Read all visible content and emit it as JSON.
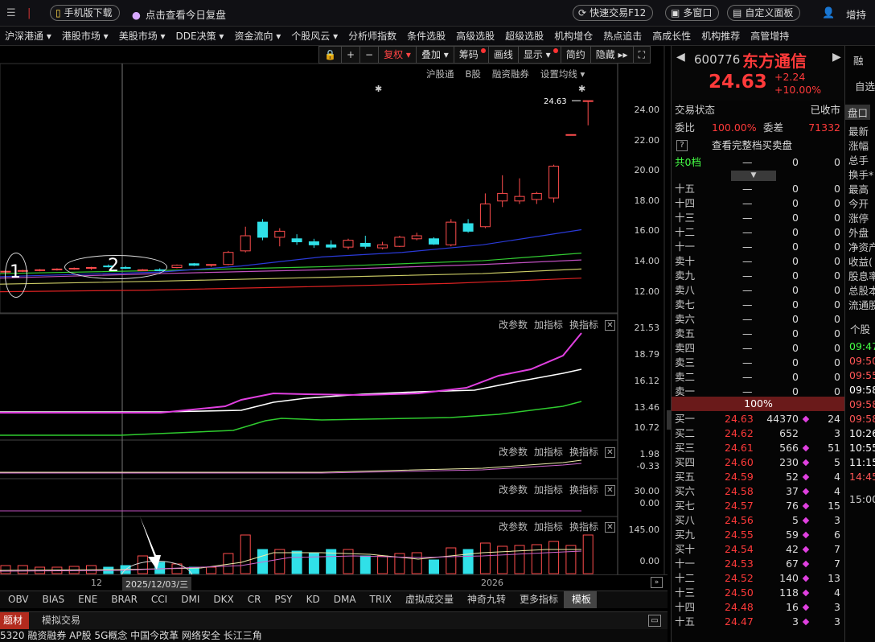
{
  "topbar": {
    "mobile_download": "手机版下载",
    "replay": "点击查看今日复盘",
    "quick_trade": "快速交易F12",
    "multi_window": "多窗口",
    "custom_panel": "自定义面板",
    "add_self": "增持"
  },
  "menu": [
    "沪深港通 ▾",
    "港股市场 ▾",
    "美股市场 ▾",
    "DDE决策 ▾",
    "资金流向 ▾",
    "个股风云 ▾",
    "分析师指数",
    "条件选股",
    "高级选股",
    "超级选股",
    "机构增仓",
    "热点追击",
    "高成长性",
    "机构推荐",
    "高管增持"
  ],
  "toolbar": {
    "fuquan": "复权",
    "diejia": "叠加",
    "chouma": "筹码",
    "huaxian": "画线",
    "xianshi": "显示",
    "jianyue": "简约",
    "yincang": "隐藏"
  },
  "subbar": [
    "沪股通",
    "B股",
    "融资融券",
    "设置均线 ▾"
  ],
  "price_axis": [
    "24.00",
    "22.00",
    "20.00",
    "18.00",
    "16.00",
    "14.00",
    "12.00"
  ],
  "price_label": "24.63",
  "annotations": {
    "one": "1",
    "two": "2",
    "date": "2025/12/03/三"
  },
  "ind_panels": [
    {
      "params": "改参数",
      "add": "加指标",
      "swap": "换指标",
      "axis": [
        "21.53",
        "18.79",
        "16.12",
        "13.46",
        "10.72"
      ]
    },
    {
      "params": "改参数",
      "add": "加指标",
      "swap": "换指标",
      "axis": [
        "1.98",
        "-0.33"
      ]
    },
    {
      "params": "改参数",
      "add": "加指标",
      "swap": "换指标",
      "axis": [
        "30.00",
        "0.00"
      ]
    },
    {
      "params": "改参数",
      "add": "加指标",
      "swap": "换指标",
      "axis": [
        "145.00",
        "0.00"
      ]
    }
  ],
  "timeaxis": {
    "left": "12",
    "year": "2026"
  },
  "bottom_tabs": [
    "OBV",
    "BIAS",
    "ENE",
    "BRAR",
    "CCI",
    "DMI",
    "DKX",
    "CR",
    "PSY",
    "KD",
    "DMA",
    "TRIX",
    "虚拟成交量",
    "神奇九转",
    "更多指标",
    "模板"
  ],
  "status_tabs": [
    "题材",
    "模拟交易"
  ],
  "status_ticker": "5320  融资融券  AP股  5G概念  中国今改革  网络安全  长江三角",
  "stock": {
    "code": "600776",
    "name": "东方通信",
    "price": "24.63",
    "change": "+2.24",
    "pct": "+10.00%",
    "state_label": "交易状态",
    "state": "已收市",
    "webi_label": "委比",
    "webi": "100.00%",
    "wecha_label": "委差",
    "wecha": "71332",
    "full_book": "查看完整档买卖盘",
    "total_label": "共0档",
    "total_dash": "—",
    "total_v": "0",
    "total_c": "0",
    "pct_bar": "100%"
  },
  "sells": [
    {
      "l": "十五",
      "p": "—",
      "v": "0",
      "c": "0"
    },
    {
      "l": "十四",
      "p": "—",
      "v": "0",
      "c": "0"
    },
    {
      "l": "十三",
      "p": "—",
      "v": "0",
      "c": "0"
    },
    {
      "l": "十二",
      "p": "—",
      "v": "0",
      "c": "0"
    },
    {
      "l": "十一",
      "p": "—",
      "v": "0",
      "c": "0"
    },
    {
      "l": "卖十",
      "p": "—",
      "v": "0",
      "c": "0"
    },
    {
      "l": "卖九",
      "p": "—",
      "v": "0",
      "c": "0"
    },
    {
      "l": "卖八",
      "p": "—",
      "v": "0",
      "c": "0"
    },
    {
      "l": "卖七",
      "p": "—",
      "v": "0",
      "c": "0"
    },
    {
      "l": "卖六",
      "p": "—",
      "v": "0",
      "c": "0"
    },
    {
      "l": "卖五",
      "p": "—",
      "v": "0",
      "c": "0"
    },
    {
      "l": "卖四",
      "p": "—",
      "v": "0",
      "c": "0"
    },
    {
      "l": "卖三",
      "p": "—",
      "v": "0",
      "c": "0"
    },
    {
      "l": "卖二",
      "p": "—",
      "v": "0",
      "c": "0"
    },
    {
      "l": "卖一",
      "p": "—",
      "v": "0",
      "c": "0"
    }
  ],
  "buys": [
    {
      "l": "买一",
      "p": "24.63",
      "v": "44370",
      "c": "24",
      "m": true
    },
    {
      "l": "买二",
      "p": "24.62",
      "v": "652",
      "c": "3",
      "m": false
    },
    {
      "l": "买三",
      "p": "24.61",
      "v": "566",
      "c": "51",
      "m": true
    },
    {
      "l": "买四",
      "p": "24.60",
      "v": "230",
      "c": "5",
      "m": true
    },
    {
      "l": "买五",
      "p": "24.59",
      "v": "52",
      "c": "4",
      "m": true
    },
    {
      "l": "买六",
      "p": "24.58",
      "v": "37",
      "c": "4",
      "m": true
    },
    {
      "l": "买七",
      "p": "24.57",
      "v": "76",
      "c": "15",
      "m": true
    },
    {
      "l": "买八",
      "p": "24.56",
      "v": "5",
      "c": "3",
      "m": true
    },
    {
      "l": "买九",
      "p": "24.55",
      "v": "59",
      "c": "6",
      "m": true
    },
    {
      "l": "买十",
      "p": "24.54",
      "v": "42",
      "c": "7",
      "m": true
    },
    {
      "l": "十一",
      "p": "24.53",
      "v": "67",
      "c": "7",
      "m": true
    },
    {
      "l": "十二",
      "p": "24.52",
      "v": "140",
      "c": "13",
      "m": true
    },
    {
      "l": "十三",
      "p": "24.50",
      "v": "118",
      "c": "4",
      "m": true
    },
    {
      "l": "十四",
      "p": "24.48",
      "v": "16",
      "c": "3",
      "m": true
    },
    {
      "l": "十五",
      "p": "24.47",
      "v": "3",
      "c": "3",
      "m": true
    }
  ],
  "far_panel": {
    "top1": "融",
    "top2": "自选",
    "items": [
      "盘口",
      "最新",
      "涨幅",
      "总手",
      "换手*",
      "最高",
      "今开",
      "涨停",
      "外盘",
      "净资产",
      "收益(",
      "股息率",
      "总股本",
      "流通股"
    ],
    "tab": "个股",
    "times": [
      "09:47",
      "09:50",
      "09:55",
      "09:58",
      "09:58",
      "09:58",
      "10:26",
      "10:55",
      "11:15",
      "14:45",
      "15:00"
    ]
  },
  "candles": [
    {
      "o": 13.3,
      "h": 13.4,
      "l": 13.25,
      "c": 13.35
    },
    {
      "o": 13.35,
      "h": 13.45,
      "l": 13.3,
      "c": 13.4
    },
    {
      "o": 13.4,
      "h": 13.5,
      "l": 13.35,
      "c": 13.45
    },
    {
      "o": 13.45,
      "h": 13.55,
      "l": 13.4,
      "c": 13.5
    },
    {
      "o": 13.5,
      "h": 13.6,
      "l": 13.45,
      "c": 13.55
    },
    {
      "o": 13.55,
      "h": 13.65,
      "l": 13.45,
      "c": 13.6
    },
    {
      "o": 13.7,
      "h": 13.8,
      "l": 13.6,
      "c": 13.65
    },
    {
      "o": 13.6,
      "h": 13.7,
      "l": 13.5,
      "c": 13.55
    },
    {
      "o": 13.45,
      "h": 13.5,
      "l": 13.4,
      "c": 13.45
    },
    {
      "o": 13.45,
      "h": 13.55,
      "l": 13.35,
      "c": 13.4
    },
    {
      "o": 13.6,
      "h": 13.8,
      "l": 13.55,
      "c": 13.75
    },
    {
      "o": 13.85,
      "h": 13.9,
      "l": 13.7,
      "c": 13.75
    },
    {
      "o": 13.75,
      "h": 13.8,
      "l": 13.65,
      "c": 13.8
    },
    {
      "o": 13.8,
      "h": 14.7,
      "l": 13.75,
      "c": 14.6
    },
    {
      "o": 14.7,
      "h": 16.3,
      "l": 14.6,
      "c": 15.7
    },
    {
      "o": 16.6,
      "h": 16.8,
      "l": 15.4,
      "c": 15.6
    },
    {
      "o": 15.6,
      "h": 16.2,
      "l": 15.0,
      "c": 16.0
    },
    {
      "o": 15.5,
      "h": 15.8,
      "l": 15.1,
      "c": 15.3
    },
    {
      "o": 15.3,
      "h": 15.5,
      "l": 14.9,
      "c": 15.1
    },
    {
      "o": 15.1,
      "h": 15.4,
      "l": 14.8,
      "c": 14.95
    },
    {
      "o": 14.95,
      "h": 15.5,
      "l": 14.8,
      "c": 15.4
    },
    {
      "o": 15.2,
      "h": 15.7,
      "l": 14.85,
      "c": 15.0
    },
    {
      "o": 14.9,
      "h": 15.3,
      "l": 14.8,
      "c": 15.1
    },
    {
      "o": 15.0,
      "h": 15.7,
      "l": 14.95,
      "c": 15.6
    },
    {
      "o": 15.5,
      "h": 15.9,
      "l": 15.4,
      "c": 15.7
    },
    {
      "o": 15.5,
      "h": 15.6,
      "l": 15.1,
      "c": 15.15
    },
    {
      "o": 15.1,
      "h": 16.8,
      "l": 15.0,
      "c": 16.6
    },
    {
      "o": 16.5,
      "h": 16.8,
      "l": 15.9,
      "c": 16.0
    },
    {
      "o": 16.3,
      "h": 18.5,
      "l": 16.2,
      "c": 17.8
    },
    {
      "o": 18.0,
      "h": 19.7,
      "l": 17.6,
      "c": 18.5
    },
    {
      "o": 18.0,
      "h": 19.5,
      "l": 17.8,
      "c": 18.3
    },
    {
      "o": 18.1,
      "h": 18.6,
      "l": 17.8,
      "c": 18.5
    },
    {
      "o": 18.2,
      "h": 20.4,
      "l": 17.9,
      "c": 20.3
    },
    {
      "o": 22.39,
      "h": 22.39,
      "l": 22.39,
      "c": 22.39
    },
    {
      "o": 24.63,
      "h": 24.63,
      "l": 23.0,
      "c": 24.63
    }
  ]
}
